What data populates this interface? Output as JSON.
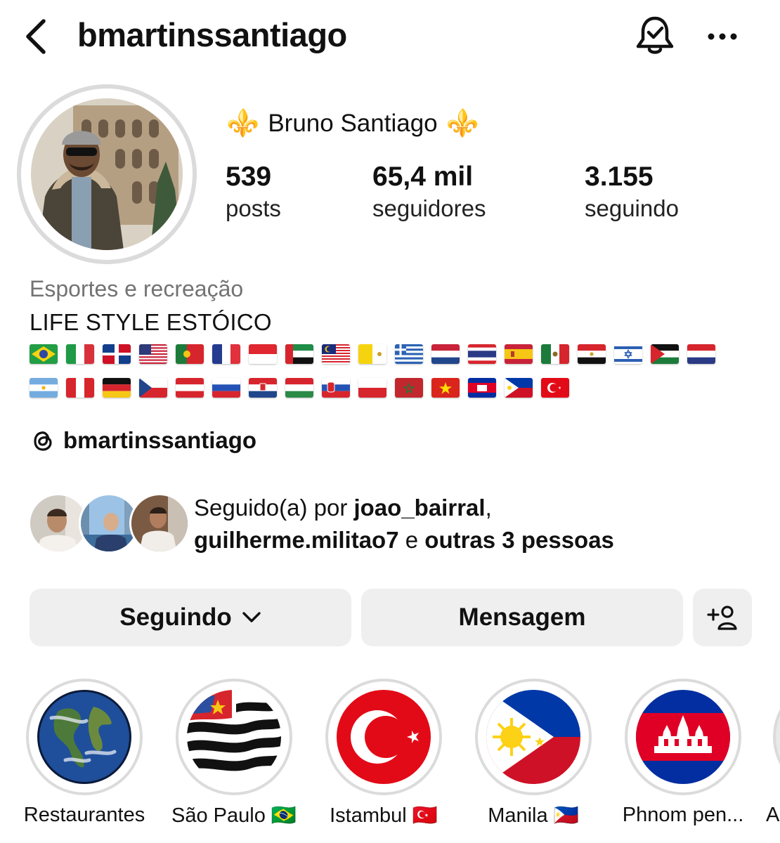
{
  "header": {
    "username": "bmartinssantiago",
    "back_icon": "chevron-left-icon",
    "bell_icon": "bell-check-icon",
    "more_icon": "ellipsis-icon"
  },
  "profile": {
    "display_name": "Bruno Santiago",
    "fleur_glyph": "⚜️",
    "stats": [
      {
        "number": "539",
        "label": "posts"
      },
      {
        "number": "65,4 mil",
        "label": "seguidores"
      },
      {
        "number": "3.155",
        "label": "seguindo"
      }
    ],
    "category": "Esportes e recreação",
    "bio": "LIFE STYLE ESTÓICO",
    "flags_row1": [
      "brazil",
      "italy",
      "dominican-republic",
      "usa",
      "portugal",
      "france",
      "indonesia",
      "uae",
      "malaysia",
      "vatican",
      "greece",
      "netherlands",
      "thailand",
      "spain",
      "mexico",
      "egypt",
      "israel",
      "jordan",
      "paraguay"
    ],
    "flags_row2": [
      "argentina",
      "peru",
      "germany",
      "czech-republic",
      "austria",
      "russia",
      "croatia",
      "hungary",
      "slovakia",
      "poland",
      "morocco",
      "vietnam",
      "cambodia",
      "philippines",
      "turkey"
    ],
    "threads_handle": "bmartinssantiago"
  },
  "followed_by": {
    "prefix": "Seguido(a) por ",
    "user1": "joao_bairral",
    "separator": ",",
    "user2": "guilherme.militao7",
    "connector": " e ",
    "others": "outras 3 pessoas"
  },
  "actions": {
    "following_label": "Seguindo",
    "message_label": "Mensagem",
    "add_user_icon": "add-person-icon"
  },
  "highlights": [
    {
      "label": "Restaurantes",
      "cover": "earth"
    },
    {
      "label": "São Paulo 🇧🇷",
      "cover": "sao-paulo-flag"
    },
    {
      "label": "Istambul 🇹🇷",
      "cover": "turkey-flag"
    },
    {
      "label": "Manila 🇵🇭",
      "cover": "philippines-flag"
    },
    {
      "label": "Phnom pen...",
      "cover": "cambodia-flag"
    },
    {
      "label": "A",
      "cover": "partial"
    }
  ],
  "colors": {
    "text": "#111111",
    "muted": "#737373",
    "button_bg": "#efefef",
    "ring": "#dbdbdb",
    "fleur": "#d8a326"
  }
}
